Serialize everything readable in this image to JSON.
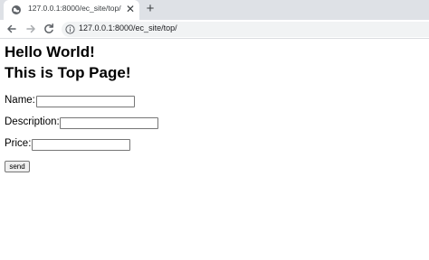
{
  "browser": {
    "tab_title": "127.0.0.1:8000/ec_site/top/",
    "tab_close_symbol": "✕",
    "new_tab_symbol": "+",
    "url": "127.0.0.1:8000/ec_site/top/",
    "icons": [
      "globe-icon",
      "close-icon",
      "plus-icon",
      "back-arrow-icon",
      "forward-arrow-icon",
      "reload-icon",
      "info-icon"
    ]
  },
  "page": {
    "heading1": "Hello World!",
    "heading2": "This is Top Page!",
    "form": {
      "name_label": "Name:",
      "name_value": "",
      "description_label": "Description:",
      "description_value": "",
      "price_label": "Price:",
      "price_value": "",
      "submit_label": "send"
    }
  }
}
